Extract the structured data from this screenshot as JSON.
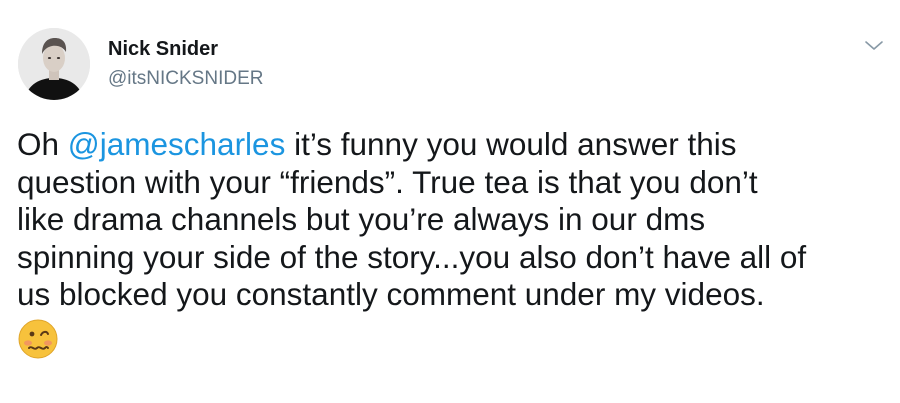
{
  "user": {
    "display_name": "Nick Snider",
    "handle": "@itsNICKSNIDER",
    "avatar_icon": "avatar-photo"
  },
  "menu": {
    "icon": "chevron-down-icon"
  },
  "tweet": {
    "line1_before": "Oh ",
    "mention": "@jamescharles",
    "line1_after": " it’s funny you would answer this",
    "line2": "question with your “friends”. True tea is that you don’t",
    "line3": "like drama channels but you’re always in our dms",
    "line4": "spinning your side of the story...you also don’t have all of",
    "line5": "us blocked you constantly comment under my videos.",
    "emoji": "woozy-face-emoji"
  },
  "colors": {
    "mention": "#1b95e0",
    "handle": "#657786",
    "text": "#14171a",
    "emoji_face": "#f7c23c"
  }
}
